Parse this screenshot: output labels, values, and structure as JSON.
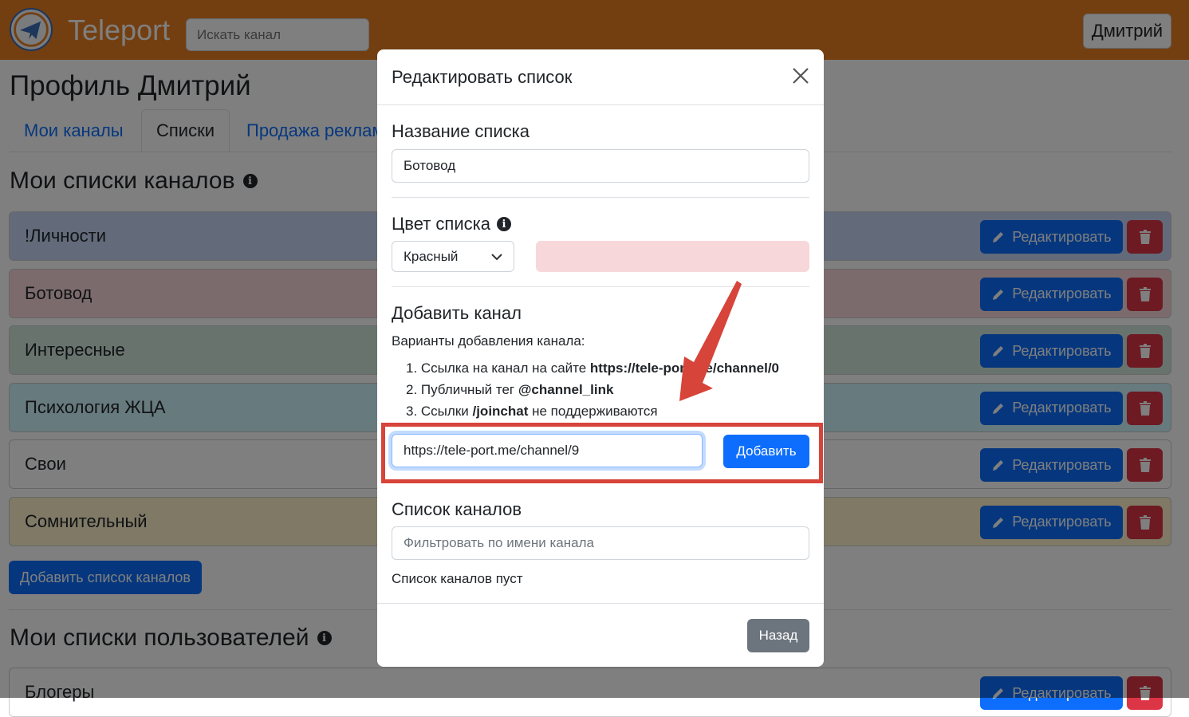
{
  "app": {
    "brand": "Teleport",
    "search_placeholder": "Искать канал",
    "user_name": "Дмитрий"
  },
  "page": {
    "title": "Профиль Дмитрий",
    "tabs": [
      "Мои каналы",
      "Списки",
      "Продажа реклам"
    ],
    "channel_lists_title": "Мои списки каналов",
    "users_lists_title": "Мои списки пользователей",
    "edit_label": "Редактировать",
    "add_list_label": "Добавить список каналов",
    "channel_lists": [
      {
        "name": "!Личности",
        "color": "#c7d5f5"
      },
      {
        "name": "Ботовод",
        "color": "#f8d7da"
      },
      {
        "name": "Интересные",
        "color": "#d1e7dd"
      },
      {
        "name": "Психология ЖЦА",
        "color": "#cff4fc"
      },
      {
        "name": "Свои",
        "color": "#ffffff"
      },
      {
        "name": "Сомнительный",
        "color": "#fff3cd"
      }
    ],
    "user_lists": [
      {
        "name": "Блогеры",
        "color": "#ffffff"
      }
    ]
  },
  "modal": {
    "title": "Редактировать список",
    "name_label": "Название списка",
    "name_value": "Ботовод",
    "color_label": "Цвет списка",
    "color_value": "Красный",
    "color_swatch": "#f8d7da",
    "add_channel_label": "Добавить канал",
    "options_intro": "Варианты добавления канала:",
    "option1_text": "1. Ссылка на канал на сайте ",
    "option1_bold": "https://tele-port.me/channel/0",
    "option2_text": "2. Публичный тег ",
    "option2_bold": "@channel_link",
    "option3_text": "3. Ссылки ",
    "option3_bold": "/joinchat",
    "option3_tail": " не поддерживаются",
    "url_value": "https://tele-port.me/channel/9",
    "add_button": "Добавить",
    "channels_label": "Список каналов",
    "filter_placeholder": "Фильтровать по имени канала",
    "empty_text": "Список каналов пуст",
    "back_button": "Назад"
  },
  "colors": {
    "navbar": "#e67e22",
    "primary": "#0d6efd",
    "danger": "#dc3545",
    "annotation": "#d7443a"
  }
}
